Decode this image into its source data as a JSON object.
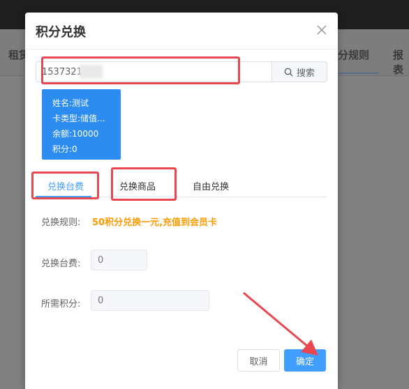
{
  "background": {
    "tab_left": "租赁",
    "tab_right1": "分规则",
    "tab_right2": "报表"
  },
  "dialog": {
    "title": "积分兑换",
    "close_icon": "close-icon"
  },
  "search": {
    "value": "15373218",
    "button_label": "搜索",
    "icon": "search-icon"
  },
  "member": {
    "name_label": "姓名:",
    "name": "测试",
    "card_type_label": "卡类型:",
    "card_type": "储值...",
    "balance_label": "余额:",
    "balance": "10000",
    "points_label": "积分:",
    "points": "0"
  },
  "tabs": [
    "兑换台费",
    "兑换商品",
    "自由兑换"
  ],
  "form": {
    "rule_label": "兑换规则:",
    "rule_text": "50积分兑换一元,充值到会员卡",
    "fee_label": "兑换台费:",
    "fee_placeholder": "0",
    "points_label": "所需积分:",
    "points_placeholder": "0"
  },
  "buttons": {
    "cancel": "取消",
    "confirm": "确定"
  },
  "colors": {
    "primary": "#409eff",
    "card": "#2d8cf0",
    "rule": "#ff9900",
    "annotation": "#e8474f"
  }
}
